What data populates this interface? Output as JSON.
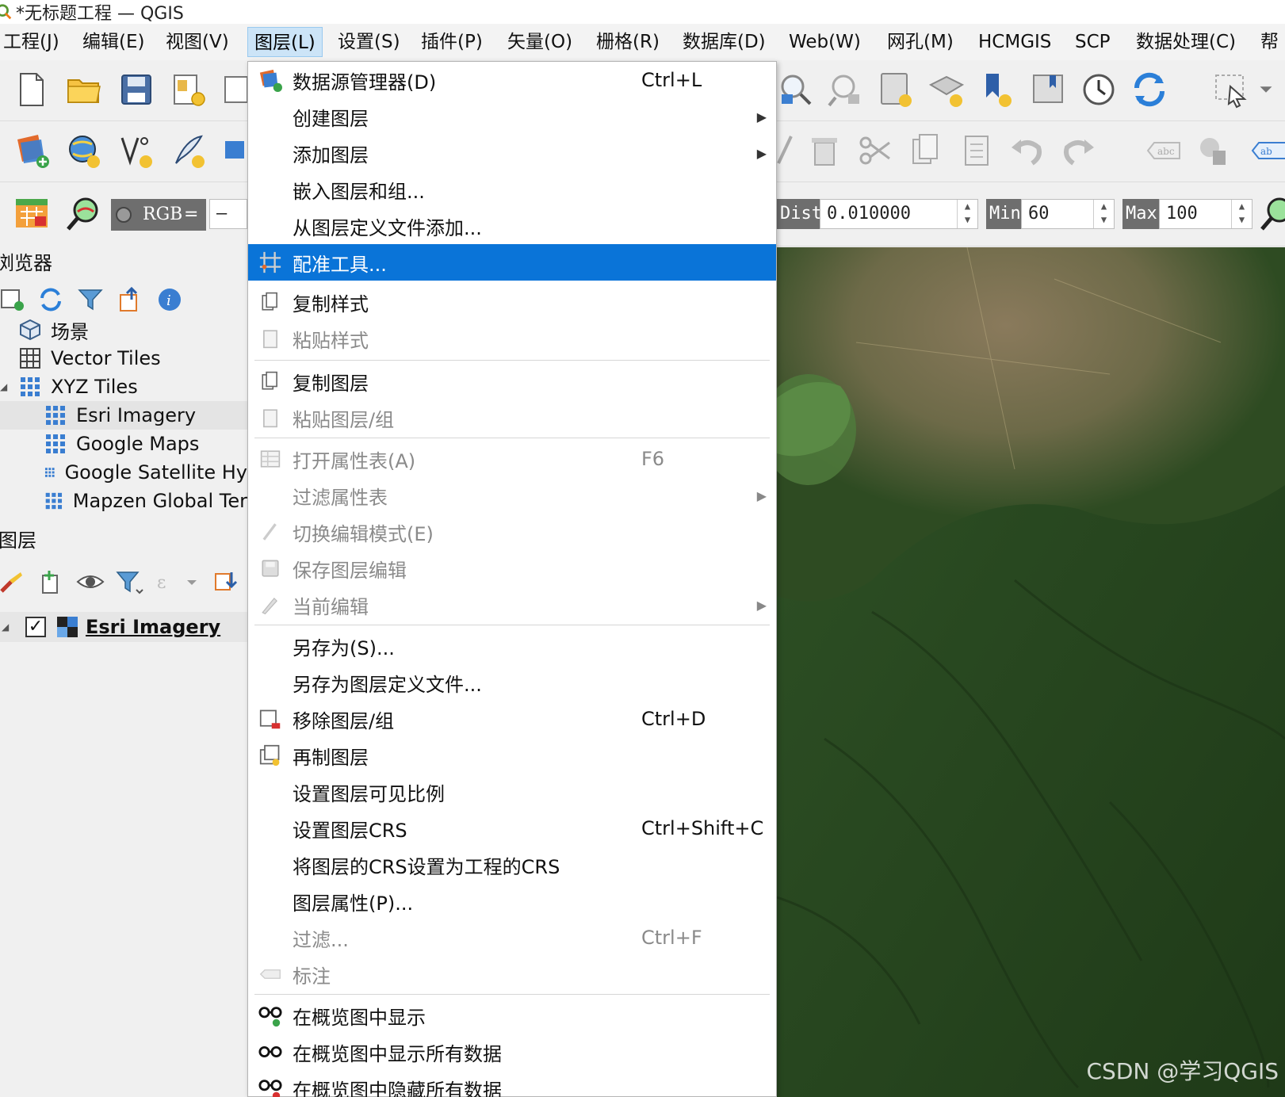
{
  "window": {
    "title": "*无标题工程 — QGIS"
  },
  "menubar": [
    {
      "label": "工程(J)"
    },
    {
      "label": "编辑(E)"
    },
    {
      "label": "视图(V)"
    },
    {
      "label": "图层(L)"
    },
    {
      "label": "设置(S)"
    },
    {
      "label": "插件(P)"
    },
    {
      "label": "矢量(O)"
    },
    {
      "label": "栅格(R)"
    },
    {
      "label": "数据库(D)"
    },
    {
      "label": "Web(W)"
    },
    {
      "label": "网孔(M)"
    },
    {
      "label": "HCMGIS"
    },
    {
      "label": "SCP"
    },
    {
      "label": "数据处理(C)"
    },
    {
      "label": "帮"
    }
  ],
  "scp_toolbar": {
    "rgb_label": "RGB",
    "rgb_eq": "=",
    "rgb_value": "–",
    "dist_label": "Dist",
    "dist_value": "0.010000",
    "min_label": "Min",
    "min_value": "60",
    "max_label": "Max",
    "max_value": "100",
    "abc_label": "abc",
    "ab_label": "ab"
  },
  "browser": {
    "title": "浏览器",
    "items": [
      {
        "label": "场景"
      },
      {
        "label": "Vector Tiles"
      },
      {
        "label": "XYZ Tiles"
      },
      {
        "label": "Esri Imagery"
      },
      {
        "label": "Google Maps"
      },
      {
        "label": "Google Satellite Hy"
      },
      {
        "label": "Mapzen Global Ter"
      }
    ]
  },
  "layers": {
    "title": "图层",
    "layer_name": "Esri Imagery",
    "checked": true
  },
  "dropdown": {
    "items": [
      {
        "label": "数据源管理器(D)",
        "shortcut": "Ctrl+L"
      },
      {
        "label": "创建图层",
        "shortcut": ""
      },
      {
        "label": "添加图层",
        "shortcut": ""
      },
      {
        "label": "嵌入图层和组...",
        "shortcut": ""
      },
      {
        "label": "从图层定义文件添加...",
        "shortcut": ""
      },
      {
        "label": "配准工具...",
        "shortcut": ""
      },
      {
        "label": "复制样式",
        "shortcut": ""
      },
      {
        "label": "粘贴样式",
        "shortcut": ""
      },
      {
        "label": "复制图层",
        "shortcut": ""
      },
      {
        "label": "粘贴图层/组",
        "shortcut": ""
      },
      {
        "label": "打开属性表(A)",
        "shortcut": "F6"
      },
      {
        "label": "过滤属性表",
        "shortcut": ""
      },
      {
        "label": "切换编辑模式(E)",
        "shortcut": ""
      },
      {
        "label": "保存图层编辑",
        "shortcut": ""
      },
      {
        "label": "当前编辑",
        "shortcut": ""
      },
      {
        "label": "另存为(S)...",
        "shortcut": ""
      },
      {
        "label": "另存为图层定义文件...",
        "shortcut": ""
      },
      {
        "label": "移除图层/组",
        "shortcut": "Ctrl+D"
      },
      {
        "label": "再制图层",
        "shortcut": ""
      },
      {
        "label": "设置图层可见比例",
        "shortcut": ""
      },
      {
        "label": "设置图层CRS",
        "shortcut": "Ctrl+Shift+C"
      },
      {
        "label": "将图层的CRS设置为工程的CRS",
        "shortcut": ""
      },
      {
        "label": "图层属性(P)...",
        "shortcut": ""
      },
      {
        "label": "过滤...",
        "shortcut": "Ctrl+F"
      },
      {
        "label": "标注",
        "shortcut": ""
      },
      {
        "label": "在概览图中显示",
        "shortcut": ""
      },
      {
        "label": "在概览图中显示所有数据",
        "shortcut": ""
      },
      {
        "label": "在概览图中隐藏所有数据",
        "shortcut": ""
      }
    ]
  },
  "map": {
    "watermark": "CSDN @学习QGIS"
  },
  "colors": {
    "highlight": "#0a74d8",
    "map_green": "#2d4a23",
    "map_urban": "#7a6a4a"
  }
}
